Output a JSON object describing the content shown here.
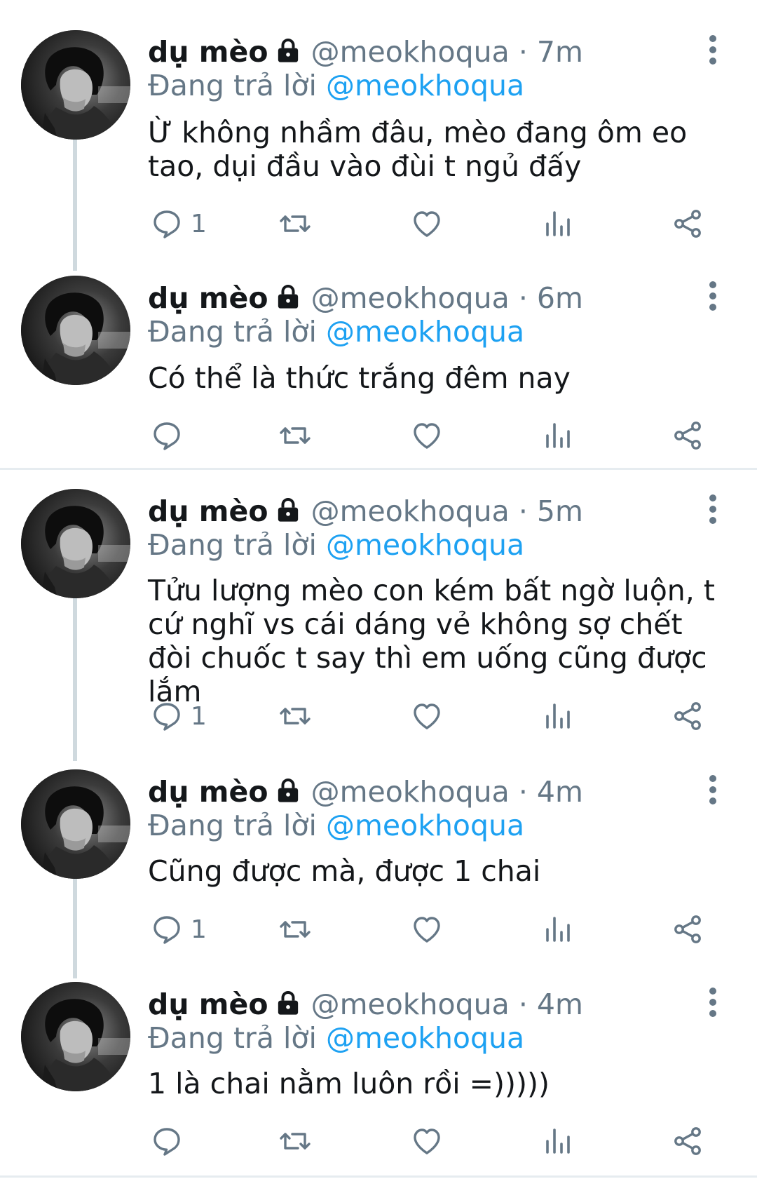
{
  "tweets": [
    {
      "name": "dụ mèo",
      "handle": "@meokhoqua",
      "separator": "·",
      "time": "7m",
      "reply_prefix": "Đang trả lời",
      "reply_to": "@meokhoqua",
      "text": "Ừ không nhầm đâu, mèo đang ôm eo tao, dụi đầu vào đùi t ngủ đấy",
      "reply_count": "1"
    },
    {
      "name": "dụ mèo",
      "handle": "@meokhoqua",
      "separator": "·",
      "time": "6m",
      "reply_prefix": "Đang trả lời",
      "reply_to": "@meokhoqua",
      "text": "Có thể là thức trắng đêm nay",
      "reply_count": ""
    },
    {
      "name": "dụ mèo",
      "handle": "@meokhoqua",
      "separator": "·",
      "time": "5m",
      "reply_prefix": "Đang trả lời",
      "reply_to": "@meokhoqua",
      "text": "Tửu lượng mèo con kém bất ngờ luộn, t cứ nghĩ vs cái dáng vẻ không sợ chết đòi chuốc t say thì em uống cũng được lắm",
      "reply_count": "1"
    },
    {
      "name": "dụ mèo",
      "handle": "@meokhoqua",
      "separator": "·",
      "time": "4m",
      "reply_prefix": "Đang trả lời",
      "reply_to": "@meokhoqua",
      "text": "Cũng được mà, được 1 chai",
      "reply_count": "1"
    },
    {
      "name": "dụ mèo",
      "handle": "@meokhoqua",
      "separator": "·",
      "time": "4m",
      "reply_prefix": "Đang trả lời",
      "reply_to": "@meokhoqua",
      "text": "1 là chai nằm luôn rồi =)))))",
      "reply_count": ""
    }
  ],
  "icons": {
    "reply": "reply-icon",
    "retweet": "retweet-icon",
    "like": "heart-icon",
    "analytics": "analytics-icon",
    "share": "share-icon",
    "lock": "lock-icon",
    "more": "more-vertical-icon"
  },
  "colors": {
    "text": "#14171a",
    "secondary": "#657786",
    "accent": "#1da1f2",
    "thread_line": "#cfd9de",
    "divider": "#e6ecf0"
  }
}
